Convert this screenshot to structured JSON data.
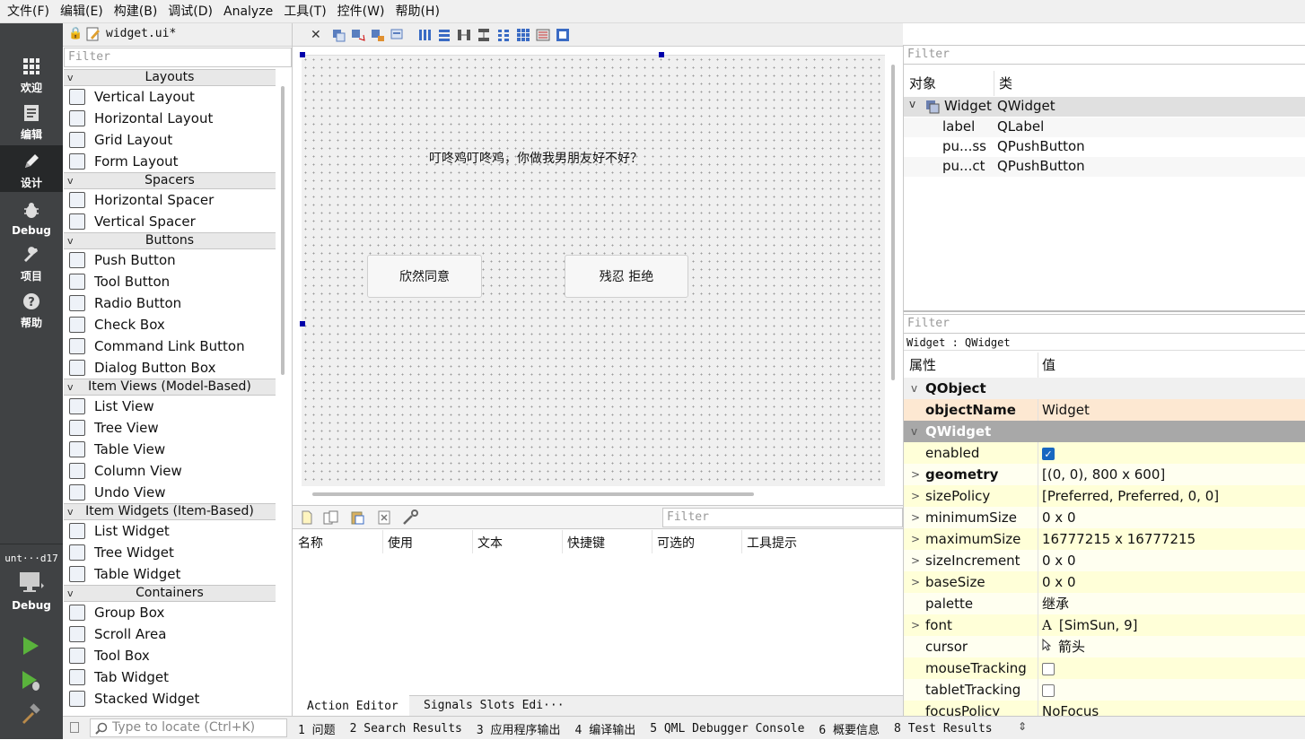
{
  "menubar": {
    "items": [
      "文件(F)",
      "编辑(E)",
      "构建(B)",
      "调试(D)",
      "Analyze",
      "工具(T)",
      "控件(W)",
      "帮助(H)"
    ]
  },
  "modes": [
    {
      "label": "欢迎",
      "icon": "grid-icon"
    },
    {
      "label": "编辑",
      "icon": "document-icon"
    },
    {
      "label": "设计",
      "icon": "pencil-icon",
      "active": true
    },
    {
      "label": "Debug",
      "icon": "bug-icon"
    },
    {
      "label": "项目",
      "icon": "wrench-icon"
    },
    {
      "label": "帮助",
      "icon": "help-icon"
    }
  ],
  "kit": {
    "name": "unt···d17",
    "mode": "Debug"
  },
  "editor": {
    "file_tab": "widget.ui*"
  },
  "widgetbox": {
    "filter_placeholder": "Filter",
    "categories": [
      {
        "title": "Layouts",
        "items": [
          "Vertical Layout",
          "Horizontal Layout",
          "Grid Layout",
          "Form Layout"
        ]
      },
      {
        "title": "Spacers",
        "items": [
          "Horizontal Spacer",
          "Vertical Spacer"
        ]
      },
      {
        "title": "Buttons",
        "items": [
          "Push Button",
          "Tool Button",
          "Radio Button",
          "Check Box",
          "Command Link Button",
          "Dialog Button Box"
        ]
      },
      {
        "title": "Item Views (Model-Based)",
        "items": [
          "List View",
          "Tree View",
          "Table View",
          "Column View",
          "Undo View"
        ]
      },
      {
        "title": "Item Widgets (Item-Based)",
        "items": [
          "List Widget",
          "Tree Widget",
          "Table Widget"
        ]
      },
      {
        "title": "Containers",
        "items": [
          "Group Box",
          "Scroll Area",
          "Tool Box",
          "Tab Widget",
          "Stacked Widget"
        ]
      }
    ]
  },
  "form": {
    "label_text": "叮咚鸡叮咚鸡，你做我男朋友好不好？",
    "btn_accept": "欣然同意",
    "btn_reject": "残忍 拒绝"
  },
  "action_editor": {
    "filter_placeholder": "Filter",
    "columns": [
      "名称",
      "使用",
      "文本",
      "快捷键",
      "可选的",
      "工具提示"
    ],
    "tabs": [
      "Action Editor",
      "Signals  Slots Edi···"
    ]
  },
  "inspector": {
    "filter_placeholder": "Filter",
    "col_object": "对象",
    "col_class": "类",
    "rows": [
      {
        "name": "Widget",
        "cls": "QWidget"
      },
      {
        "name": "label",
        "cls": "QLabel"
      },
      {
        "name": "pu...ss",
        "cls": "QPushButton"
      },
      {
        "name": "pu...ct",
        "cls": "QPushButton"
      }
    ]
  },
  "property_editor": {
    "filter_placeholder": "Filter",
    "context": "Widget : QWidget",
    "col_prop": "属性",
    "col_value": "值",
    "rows": [
      {
        "kind": "group",
        "name": "QObject"
      },
      {
        "kind": "prop",
        "name": "objectName",
        "value": "Widget",
        "bold": true,
        "bg": "#fde8d2"
      },
      {
        "kind": "group2",
        "name": "QWidget"
      },
      {
        "kind": "prop",
        "name": "enabled",
        "value": "",
        "check": "on",
        "bg": "#ffffd8"
      },
      {
        "kind": "prop",
        "name": "geometry",
        "value": "[(0, 0), 800 x 600]",
        "bold": true,
        "expand": true,
        "bg": "#fffff0"
      },
      {
        "kind": "prop",
        "name": "sizePolicy",
        "value": "[Preferred, Preferred, 0, 0]",
        "expand": true,
        "bg": "#ffffd8"
      },
      {
        "kind": "prop",
        "name": "minimumSize",
        "value": "0 x 0",
        "expand": true,
        "bg": "#fffff0"
      },
      {
        "kind": "prop",
        "name": "maximumSize",
        "value": "16777215 x 16777215",
        "expand": true,
        "bg": "#ffffd8"
      },
      {
        "kind": "prop",
        "name": "sizeIncrement",
        "value": "0 x 0",
        "expand": true,
        "bg": "#fffff0"
      },
      {
        "kind": "prop",
        "name": "baseSize",
        "value": "0 x 0",
        "expand": true,
        "bg": "#ffffd8"
      },
      {
        "kind": "prop",
        "name": "palette",
        "value": "继承",
        "bg": "#fffff0"
      },
      {
        "kind": "prop",
        "name": "font",
        "value": "[SimSun, 9]",
        "expand": true,
        "bg": "#ffffd8",
        "icon": "A"
      },
      {
        "kind": "prop",
        "name": "cursor",
        "value": "箭头",
        "bg": "#fffff0",
        "icon": "cursor"
      },
      {
        "kind": "prop",
        "name": "mouseTracking",
        "value": "",
        "check": "off",
        "bg": "#ffffd8"
      },
      {
        "kind": "prop",
        "name": "tabletTracking",
        "value": "",
        "check": "off",
        "bg": "#fffff0"
      },
      {
        "kind": "prop",
        "name": "focusPolicy",
        "value": "NoFocus",
        "bg": "#ffffd8"
      }
    ]
  },
  "statusbar": {
    "locate_placeholder": "Type to locate (Ctrl+K)",
    "panes": [
      "1 问题",
      "2 Search Results",
      "3 应用程序输出",
      "4 编译输出",
      "5 QML Debugger Console",
      "6 概要信息",
      "8 Test Results"
    ]
  }
}
